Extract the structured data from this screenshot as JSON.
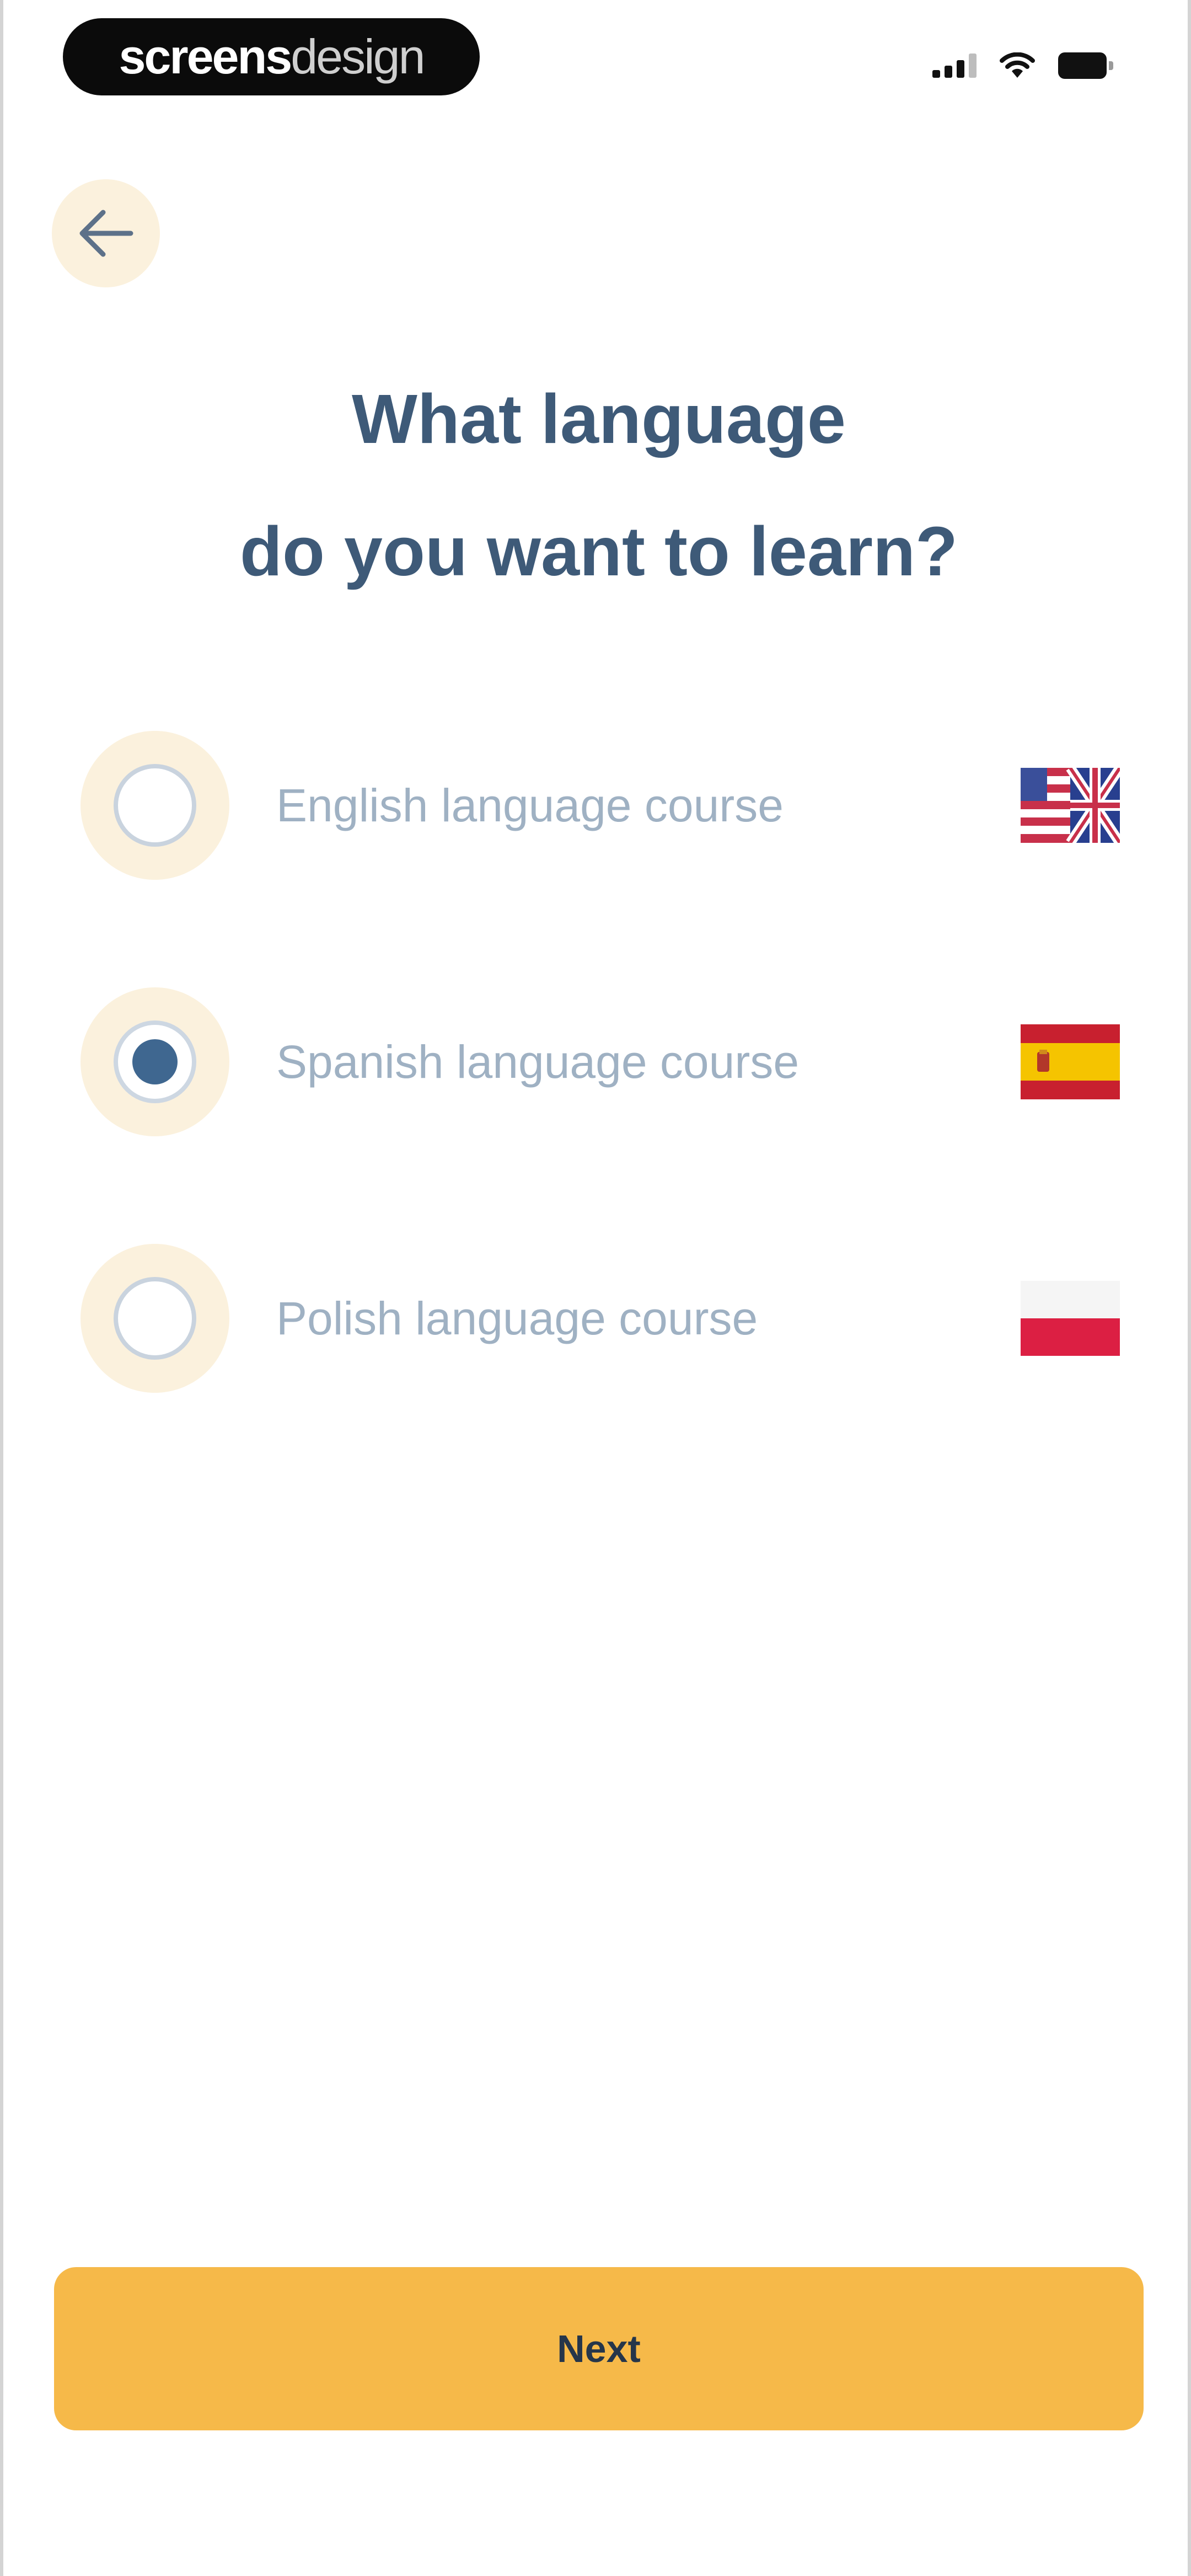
{
  "status_bar": {
    "brand_bold": "screens",
    "brand_light": "design",
    "icons": [
      "cellular-signal-icon",
      "wifi-icon",
      "battery-icon"
    ]
  },
  "header": {
    "back_icon": "arrow-left-icon"
  },
  "title": {
    "line1": "What language",
    "line2": "do you want to learn?"
  },
  "options": [
    {
      "label": "English language course",
      "selected": false,
      "flag": "flag-us-uk-icon"
    },
    {
      "label": "Spanish language course",
      "selected": true,
      "flag": "flag-spain-icon"
    },
    {
      "label": "Polish language course",
      "selected": false,
      "flag": "flag-poland-icon"
    }
  ],
  "footer": {
    "next_label": "Next"
  },
  "colors": {
    "accent": "#f6b949",
    "title": "#3e5a78",
    "label": "#9fb1c3",
    "halo": "#fbf1dd",
    "radio_selected": "#3f6790"
  }
}
